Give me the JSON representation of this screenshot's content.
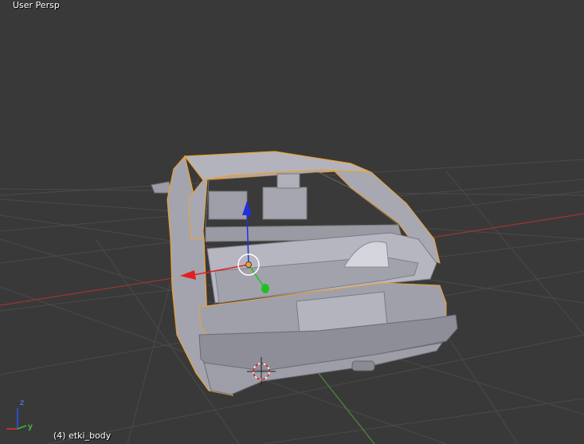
{
  "viewport": {
    "view_label": "User Persp",
    "object_label": "(4) etki_body"
  },
  "axis_widget": {
    "z_label": "z",
    "y_label": "y"
  },
  "colors": {
    "background": "#393939",
    "grid": "#4a4a4a",
    "x_axis": "#a03434",
    "y_axis": "#4f8a3a",
    "selection_outline": "#f0a030",
    "mesh": "#a9a9b4",
    "gizmo_x": "#e02020",
    "gizmo_y": "#20c020",
    "gizmo_z": "#2030e0"
  },
  "icons": {
    "manipulator": "transform-manipulator-icon",
    "cursor": "3d-cursor-icon",
    "origin": "object-origin-icon"
  }
}
